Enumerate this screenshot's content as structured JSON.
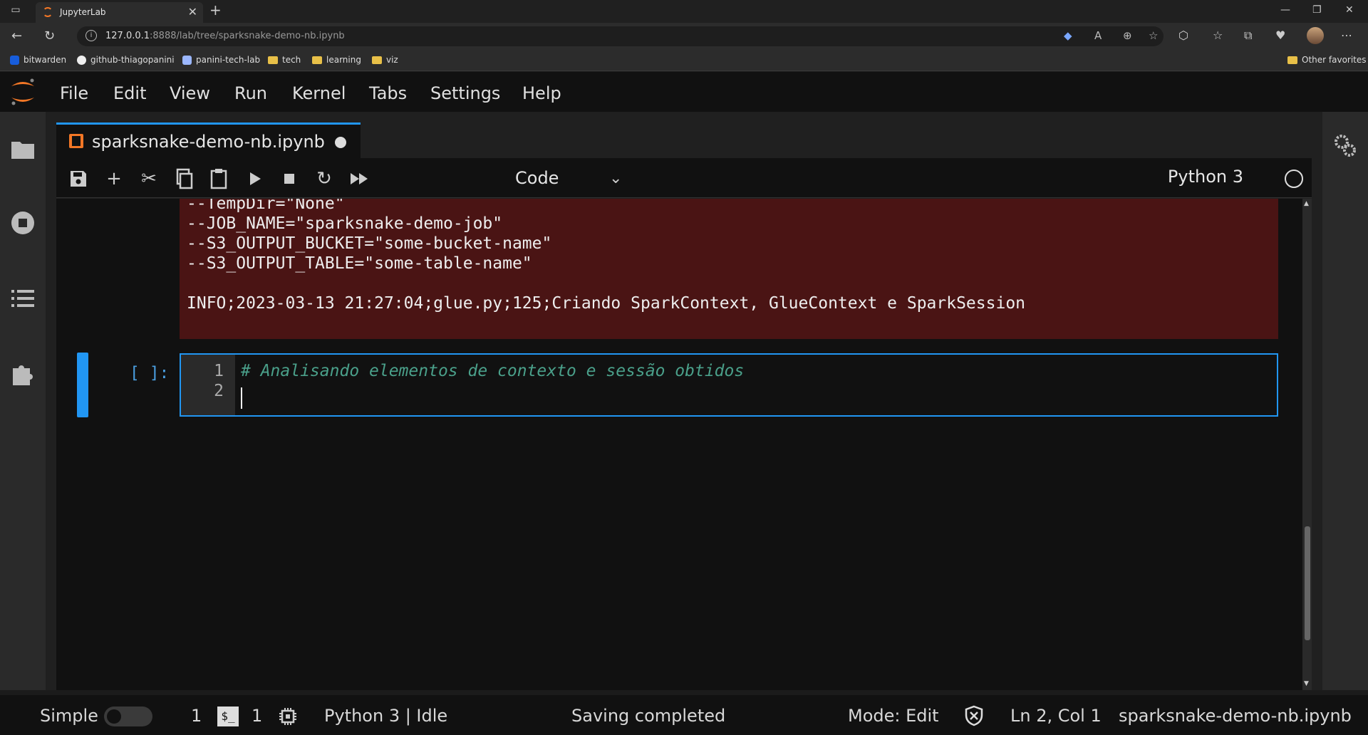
{
  "browser": {
    "tab_title": "JupyterLab",
    "url_host": "127.0.0.1",
    "url_rest": ":8888/lab/tree/sparksnake-demo-nb.ipynb",
    "bookmarks": [
      "bitwarden",
      "github-thiagopanini",
      "panini-tech-lab",
      "tech",
      "learning",
      "viz"
    ],
    "other_favorites": "Other favorites"
  },
  "menu": {
    "items": [
      "File",
      "Edit",
      "View",
      "Run",
      "Kernel",
      "Tabs",
      "Settings",
      "Help"
    ]
  },
  "notebook": {
    "tab_name": "sparksnake-demo-nb.ipynb",
    "cell_type": "Code",
    "kernel": "Python 3"
  },
  "output": {
    "lines": [
      "--TempDir=\"None\"",
      "--JOB_NAME=\"sparksnake-demo-job\"",
      "--S3_OUTPUT_BUCKET=\"some-bucket-name\"",
      "--S3_OUTPUT_TABLE=\"some-table-name\"",
      "INFO;2023-03-13 21:27:04;glue.py;125;Criando SparkContext, GlueContext e SparkSession"
    ]
  },
  "cell": {
    "prompt": "[ ]:",
    "line_numbers": [
      "1",
      "2"
    ],
    "code_line1": "# Analisando elementos de contexto e sessão obtidos"
  },
  "status": {
    "mode_label": "Simple",
    "terminals_count": "1",
    "kernels_count": "1",
    "kernel_state": "Python 3 | Idle",
    "save_state": "Saving completed",
    "mode": "Mode: Edit",
    "cursor": "Ln 2, Col 1",
    "file": "sparksnake-demo-nb.ipynb"
  },
  "colors": {
    "accent": "#2196f3",
    "jupyter_orange": "#f37726",
    "stderr_bg": "#4a1414"
  }
}
